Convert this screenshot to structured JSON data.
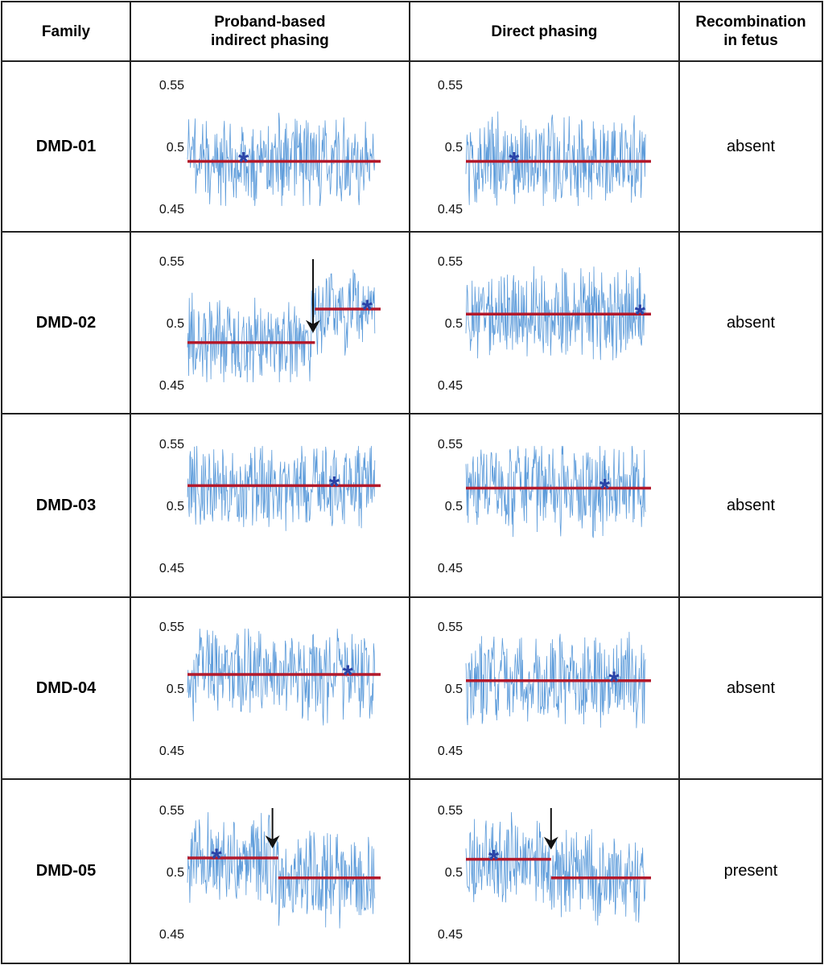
{
  "headers": {
    "family": "Family",
    "indirect": "Proband-based\nindirect phasing",
    "indirect_l1": "Proband-based",
    "indirect_l2": "indirect phasing",
    "direct": "Direct phasing",
    "recomb_l1": "Recombination",
    "recomb_l2": "in fetus"
  },
  "colors": {
    "trace": "#4a90d6",
    "mean_line": "#b3192b",
    "asterisk": "#2a44a8",
    "arrow": "#111111"
  },
  "chart_data": {
    "type": "line",
    "title": "",
    "ylabel": "",
    "ylim": [
      0.45,
      0.55
    ],
    "yticks": [
      "0.55",
      "0.5",
      "0.45"
    ],
    "rows": [
      {
        "family": "DMD-01",
        "recombination": "absent",
        "indirect": {
          "segments": [
            {
              "from": 0,
              "to": 1,
              "level": 0.488
            }
          ],
          "asterisk_x": 0.29,
          "arrow_x": null
        },
        "direct": {
          "segments": [
            {
              "from": 0,
              "to": 1,
              "level": 0.488
            }
          ],
          "asterisk_x": 0.26,
          "arrow_x": null
        }
      },
      {
        "family": "DMD-02",
        "recombination": "absent",
        "indirect": {
          "segments": [
            {
              "from": 0,
              "to": 0.66,
              "level": 0.484
            },
            {
              "from": 0.66,
              "to": 1,
              "level": 0.511
            }
          ],
          "asterisk_x": 0.93,
          "arrow_x": 0.65
        },
        "direct": {
          "segments": [
            {
              "from": 0,
              "to": 1,
              "level": 0.507
            }
          ],
          "asterisk_x": 0.94,
          "arrow_x": null
        }
      },
      {
        "family": "DMD-03",
        "recombination": "absent",
        "indirect": {
          "segments": [
            {
              "from": 0,
              "to": 1,
              "level": 0.516
            }
          ],
          "asterisk_x": 0.76,
          "arrow_x": null
        },
        "direct": {
          "segments": [
            {
              "from": 0,
              "to": 1,
              "level": 0.514
            }
          ],
          "asterisk_x": 0.75,
          "arrow_x": null
        }
      },
      {
        "family": "DMD-04",
        "recombination": "absent",
        "indirect": {
          "segments": [
            {
              "from": 0,
              "to": 1,
              "level": 0.511
            }
          ],
          "asterisk_x": 0.83,
          "arrow_x": null
        },
        "direct": {
          "segments": [
            {
              "from": 0,
              "to": 1,
              "level": 0.506
            }
          ],
          "asterisk_x": 0.8,
          "arrow_x": null
        }
      },
      {
        "family": "DMD-05",
        "recombination": "present",
        "indirect": {
          "segments": [
            {
              "from": 0,
              "to": 0.47,
              "level": 0.511
            },
            {
              "from": 0.47,
              "to": 1,
              "level": 0.495
            }
          ],
          "asterisk_x": 0.15,
          "arrow_x": 0.44
        },
        "direct": {
          "segments": [
            {
              "from": 0,
              "to": 0.46,
              "level": 0.51
            },
            {
              "from": 0.46,
              "to": 1,
              "level": 0.495
            }
          ],
          "asterisk_x": 0.15,
          "arrow_x": 0.46
        }
      }
    ]
  }
}
